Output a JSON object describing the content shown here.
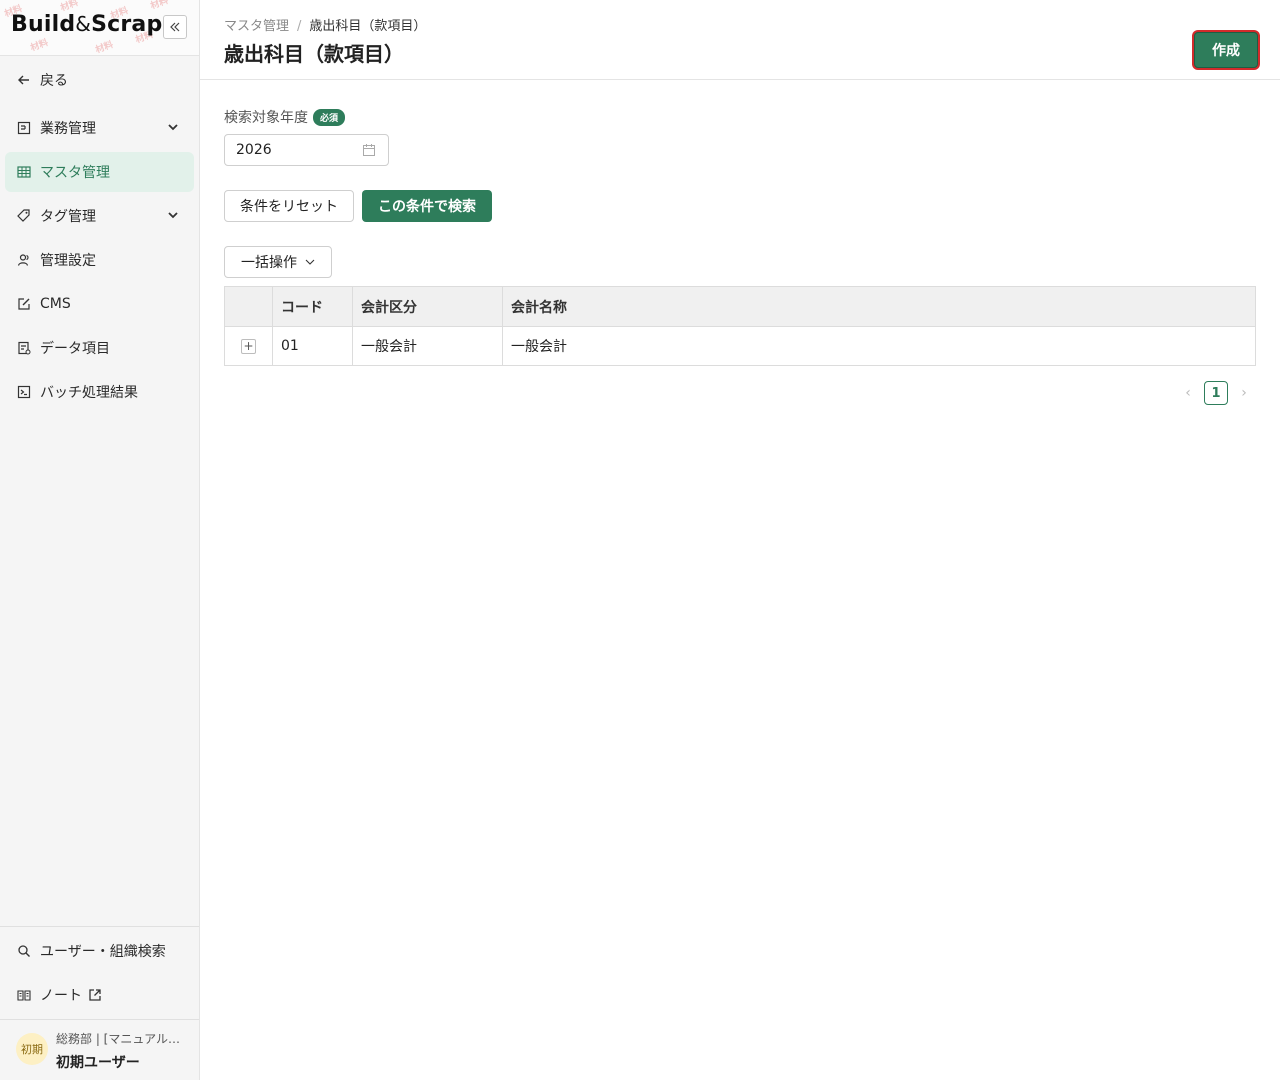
{
  "logo": {
    "part1": "Build",
    "amp": "&",
    "part2": "Scrap",
    "watermark": "材料"
  },
  "sidebar": {
    "collapse_icon": "double-chevron-left-icon",
    "items": [
      {
        "label": "戻る",
        "icon": "arrow-left-icon"
      },
      {
        "label": "業務管理",
        "icon": "document-icon",
        "expandable": true
      },
      {
        "label": "マスタ管理",
        "icon": "table-icon",
        "active": true
      },
      {
        "label": "タグ管理",
        "icon": "tag-icon",
        "expandable": true
      },
      {
        "label": "管理設定",
        "icon": "users-icon"
      },
      {
        "label": "CMS",
        "icon": "edit-icon"
      },
      {
        "label": "データ項目",
        "icon": "form-icon"
      },
      {
        "label": "バッチ処理結果",
        "icon": "terminal-icon"
      }
    ],
    "bottom_items": [
      {
        "label": "ユーザー・組織検索",
        "icon": "search-icon"
      },
      {
        "label": "ノート",
        "icon": "book-icon",
        "external_icon": "external-link-icon"
      }
    ],
    "user": {
      "avatar": "初期",
      "org": "総務部 | [マニュアル用]",
      "name": "初期ユーザー"
    }
  },
  "header": {
    "breadcrumb": [
      "マスタ管理",
      "歳出科目（款項目）"
    ],
    "breadcrumb_sep": "/",
    "title": "歳出科目（款項目）",
    "create_label": "作成"
  },
  "search": {
    "year_label": "検索対象年度",
    "required_badge": "必須",
    "year_value": "2026",
    "reset_label": "条件をリセット",
    "search_label": "この条件で検索"
  },
  "bulk": {
    "label": "一括操作"
  },
  "table": {
    "columns": [
      "",
      "コード",
      "会計区分",
      "会計名称"
    ],
    "rows": [
      {
        "expand": "+",
        "code": "01",
        "category": "一般会計",
        "name": "一般会計"
      }
    ]
  },
  "pagination": {
    "prev": "‹",
    "current": "1",
    "next": "›"
  },
  "colors": {
    "accent": "#2e7d5b",
    "active_bg": "#e2f1ea",
    "highlight": "#d22b2b"
  }
}
